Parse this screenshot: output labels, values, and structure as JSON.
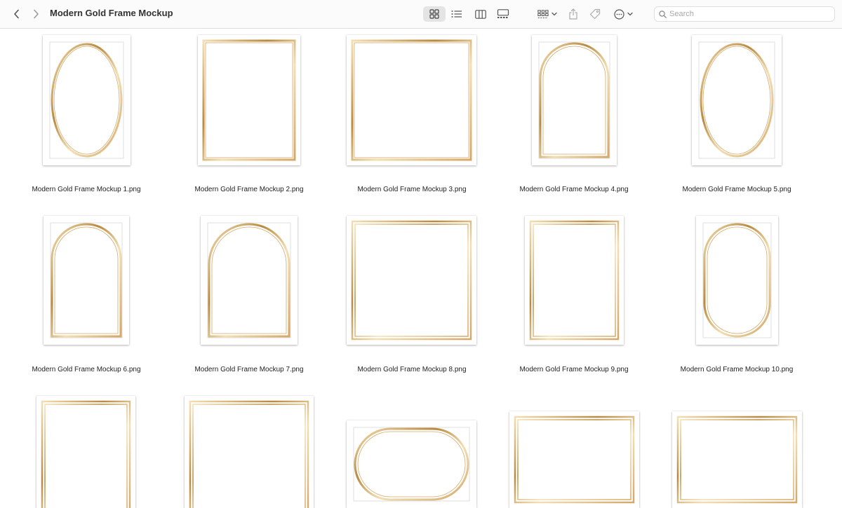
{
  "window": {
    "title": "Modern Gold Frame Mockup"
  },
  "toolbar": {
    "back_icon": "chevron-left-icon",
    "forward_icon": "chevron-right-icon",
    "view_modes": [
      "icon-view-icon",
      "list-view-icon",
      "column-view-icon",
      "gallery-view-icon"
    ],
    "active_view": "icon-view-icon",
    "group_icon": "group-by-icon",
    "share_icon": "share-icon",
    "tag_icon": "tag-icon",
    "more_icon": "more-actions-icon",
    "search": {
      "placeholder": "Search",
      "value": ""
    }
  },
  "colors": {
    "gold_light": "#f3dfb3",
    "gold_mid": "#d4a868",
    "gold_dark": "#b98a3f",
    "rose_gold": "#c9a580",
    "toolbar_bg": "#fbfbfb"
  },
  "files": [
    {
      "name": "Modern Gold Frame Mockup 1.png",
      "frame": "oval",
      "inner_border": true
    },
    {
      "name": "Modern Gold Frame Mockup 2.png",
      "frame": "rect",
      "inner_border": false
    },
    {
      "name": "Modern Gold Frame Mockup 3.png",
      "frame": "rect",
      "inner_border": false
    },
    {
      "name": "Modern Gold Frame Mockup 4.png",
      "frame": "arch",
      "inner_border": true
    },
    {
      "name": "Modern Gold Frame Mockup 5.png",
      "frame": "oval",
      "inner_border": true
    },
    {
      "name": "Modern Gold Frame Mockup 6.png",
      "frame": "arch",
      "inner_border": true
    },
    {
      "name": "Modern Gold Frame Mockup 7.png",
      "frame": "arch",
      "inner_border": true
    },
    {
      "name": "Modern Gold Frame Mockup 8.png",
      "frame": "rect-double",
      "inner_border": false
    },
    {
      "name": "Modern Gold Frame Mockup 9.png",
      "frame": "rect-double",
      "inner_border": false
    },
    {
      "name": "Modern Gold Frame Mockup 10.png",
      "frame": "capsule",
      "inner_border": true
    },
    {
      "name": "",
      "frame": "rect-double",
      "inner_border": false
    },
    {
      "name": "",
      "frame": "rect-double",
      "inner_border": false
    },
    {
      "name": "",
      "frame": "capsule-h",
      "inner_border": true
    },
    {
      "name": "",
      "frame": "rect-double",
      "inner_border": false
    },
    {
      "name": "",
      "frame": "rect-double",
      "inner_border": false
    }
  ]
}
